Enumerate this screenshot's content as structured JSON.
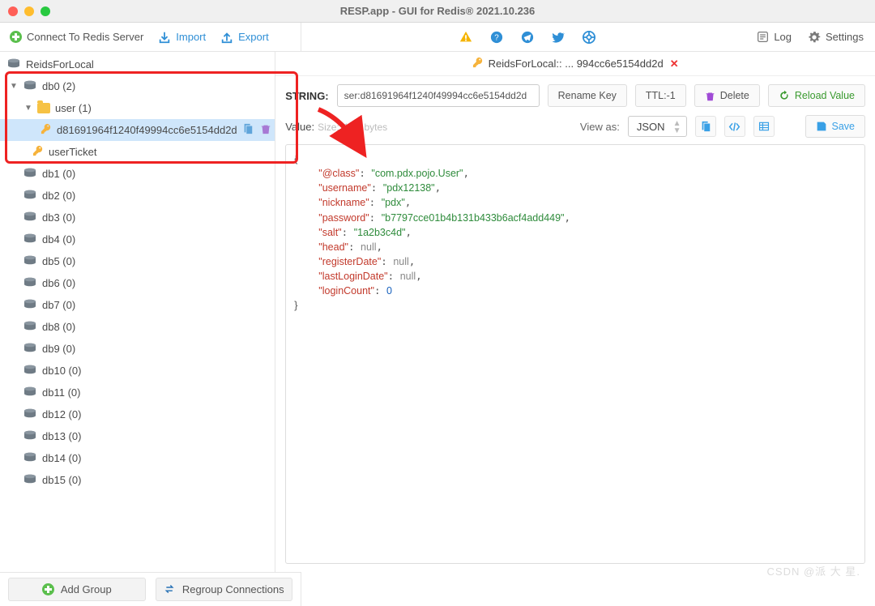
{
  "window": {
    "title": "RESP.app - GUI for Redis® 2021.10.236"
  },
  "toolbar": {
    "connect": "Connect To Redis Server",
    "import": "Import",
    "export": "Export",
    "log": "Log",
    "settings": "Settings"
  },
  "connection": {
    "name": "ReidsForLocal"
  },
  "tree": {
    "db0": "db0 (2)",
    "folder_user": "user (1)",
    "selected_key": "d81691964f1240f49994cc6e5154dd2d",
    "key_userTicket": "userTicket"
  },
  "dbs": [
    "db1 (0)",
    "db2 (0)",
    "db3 (0)",
    "db4 (0)",
    "db5 (0)",
    "db6 (0)",
    "db7 (0)",
    "db8 (0)",
    "db9 (0)",
    "db10 (0)",
    "db11 (0)",
    "db12 (0)",
    "db13 (0)",
    "db14 (0)",
    "db15 (0)"
  ],
  "sidebar_bottom": {
    "add_group": "Add Group",
    "regroup": "Regroup Connections"
  },
  "tab": {
    "label": "ReidsForLocal:: ... 994cc6e5154dd2d"
  },
  "keyctl": {
    "type": "STRING:",
    "key": "ser:d81691964f1240f49994cc6e5154dd2d",
    "rename": "Rename Key",
    "ttl": "TTL:-1",
    "delete": "Delete",
    "reload": "Reload Value"
  },
  "valctl": {
    "label": "Value:",
    "size": "Size: 196 bytes",
    "viewas": "View as:",
    "format": "JSON",
    "save": "Save"
  },
  "json_value": {
    "@class": "com.pdx.pojo.User",
    "username": "pdx12138",
    "nickname": "pdx",
    "password": "b7797cce01b4b131b433b6acf4add449",
    "salt": "1a2b3c4d",
    "head": null,
    "registerDate": null,
    "lastLoginDate": null,
    "loginCount": 0
  },
  "watermark": "CSDN @派 大 星."
}
